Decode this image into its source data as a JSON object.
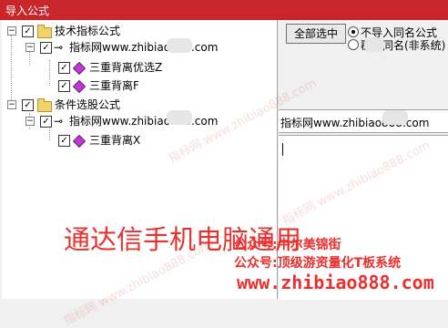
{
  "window": {
    "title": "导入公式"
  },
  "tree": {
    "nodes": [
      {
        "label": "技术指标公式"
      },
      {
        "label": "指标网www.zhibiao888.com"
      },
      {
        "label": "三重背离优选Z"
      },
      {
        "label": "三重背离F"
      },
      {
        "label": "条件选股公式"
      },
      {
        "label": "指标网www.zhibiao888.com"
      },
      {
        "label": "三重背离X"
      }
    ],
    "expander_minus": "−",
    "check": "✓",
    "key_glyph": "⊸"
  },
  "right_panel": {
    "select_all_label": "全部选中",
    "options": [
      {
        "label": "不导入同名公式",
        "selected": true
      },
      {
        "label": "覆盖同名(非系统)",
        "selected": false
      }
    ],
    "formula_name": "指标网www.zhibiao888.com"
  },
  "overlay": {
    "big_text": "通达信手机电脑通用",
    "line1": "公众号:牛尔美锦街",
    "line2": "公众号:顶级游资量化T板系统",
    "url": "www.zhibiao888.com",
    "watermark": "指标网 www.zhibiao888.com"
  },
  "colors": {
    "titlebar": "#c8262a",
    "overlay_red": "#e8302e"
  }
}
